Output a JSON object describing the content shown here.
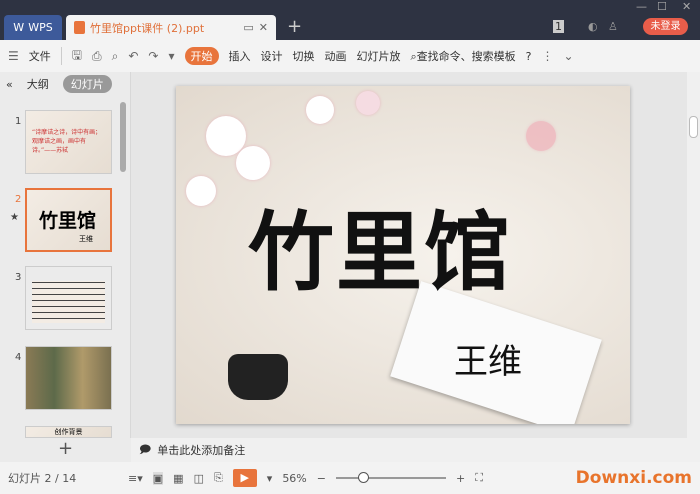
{
  "titlebar": {
    "wps_label": "WPS",
    "doc_tab": "竹里馆ppt课件 (2).ppt",
    "badge": "1",
    "login": "未登录"
  },
  "toolbar": {
    "file": "文件",
    "tabs": [
      "开始",
      "插入",
      "设计",
      "切换",
      "动画",
      "幻灯片放"
    ],
    "search": "查找命令、搜索模板",
    "help": "?"
  },
  "left": {
    "outline_tab": "大纲",
    "slides_tab": "幻灯片",
    "thumbs": [
      {
        "num": "1",
        "text": "“诗摩诘之诗，诗中有画；观摩诘之画，画中有诗。”——苏轼"
      },
      {
        "num": "2",
        "title": "竹里馆",
        "author": "王维"
      },
      {
        "num": "3"
      },
      {
        "num": "4"
      },
      {
        "num": "5",
        "text": "创作背景"
      }
    ]
  },
  "slide": {
    "title": "竹里馆",
    "author": "王维"
  },
  "notes": {
    "placeholder": "单击此处添加备注"
  },
  "status": {
    "slide_counter": "幻灯片 2 / 14",
    "zoom": "56%",
    "zoom_fraction": 0.25,
    "watermark": "Downxi.com"
  }
}
